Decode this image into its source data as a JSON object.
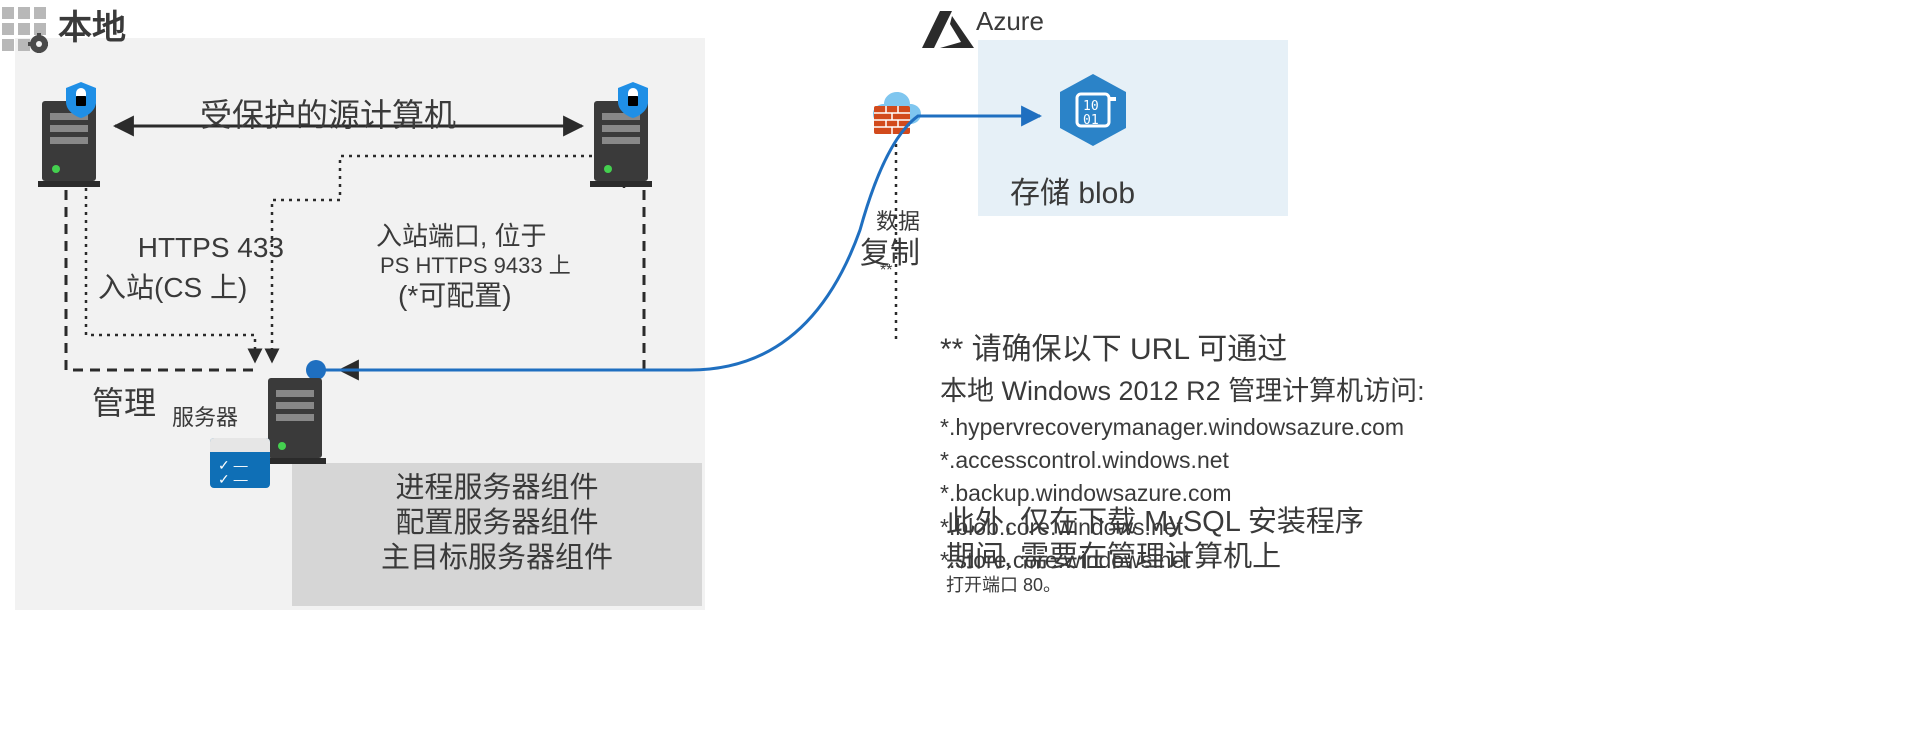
{
  "onprem": {
    "title": "本地",
    "protected_label": "受保护的源计算机",
    "https_label_1": "HTTPS 433",
    "https_label_2": "入站(CS 上)",
    "inbound_label_1": "入站端口, 位于",
    "inbound_label_2": "PS HTTPS 9433 上",
    "inbound_label_3": "(*可配置)",
    "mgmt_label": "管理",
    "server_label": "服务器",
    "component_1": "进程服务器组件",
    "component_2": "配置服务器组件",
    "component_3": "主目标服务器组件"
  },
  "replication": {
    "label_1": "数据",
    "label_2": "复制",
    "stars": "**"
  },
  "azure": {
    "title": "Azure",
    "storage_label": "存储 blob",
    "blob_text_1": "10",
    "blob_text_2": "01"
  },
  "notes": {
    "url_heading_1": "** 请确保以下 URL 可通过",
    "url_heading_2": "本地 Windows 2012 R2 管理计算机访问:",
    "url_1": "*.hypervrecoverymanager.windowsazure.com",
    "url_2": "*.accesscontrol.windows.net",
    "url_3": "*.backup.windowsazure.com",
    "url_4": "*.blob.core.windows.net",
    "url_5": "*.store.core.windows.net",
    "extra_1": "此外,  仅在下载 MySQL 安装程序",
    "extra_2": "期间,  需要在管理计算机上",
    "extra_3": "打开端口 80。"
  }
}
